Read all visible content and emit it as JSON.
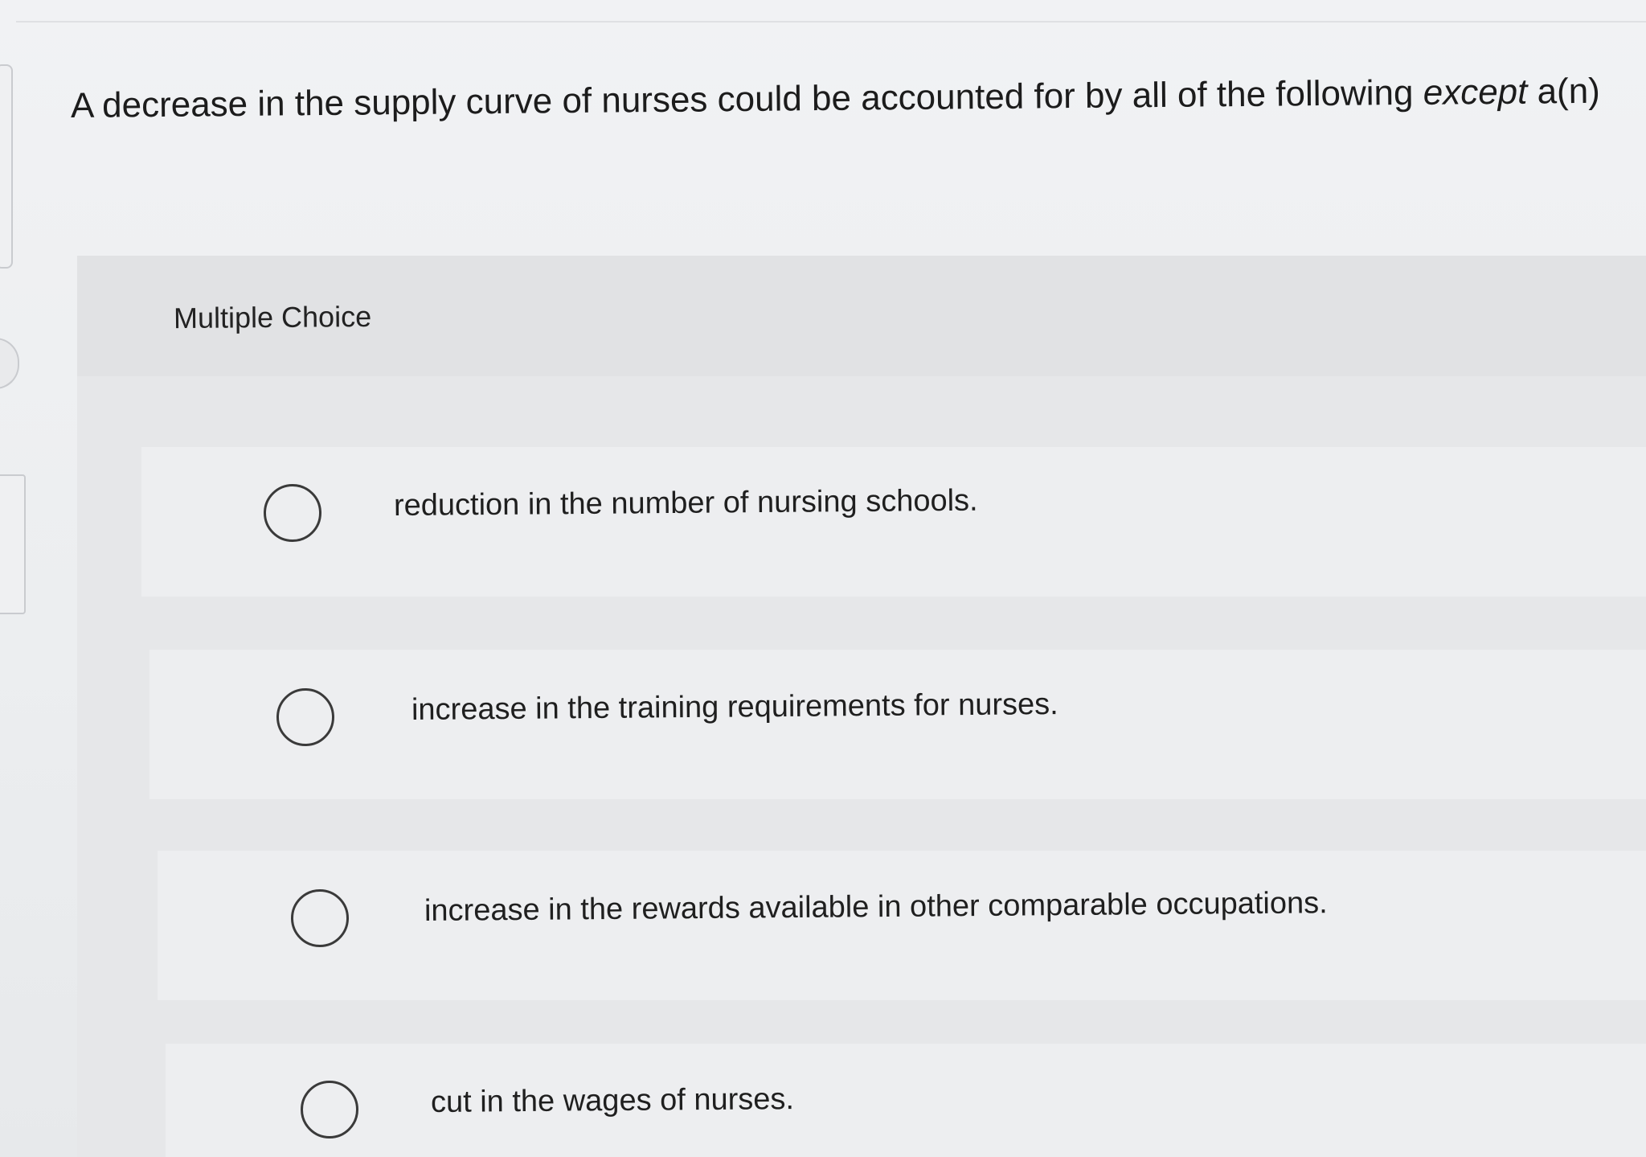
{
  "question": {
    "text_before": "A decrease in the supply curve of nurses could be accounted for by all of the following ",
    "emphasis": "except",
    "text_after": " a(n)"
  },
  "question_type": {
    "label": "Multiple Choice"
  },
  "options": [
    {
      "label": "reduction in the number of nursing schools."
    },
    {
      "label": "increase in the training requirements for nurses."
    },
    {
      "label": "increase in the rewards available in other comparable occupations."
    },
    {
      "label": "cut in the wages of nurses."
    }
  ]
}
